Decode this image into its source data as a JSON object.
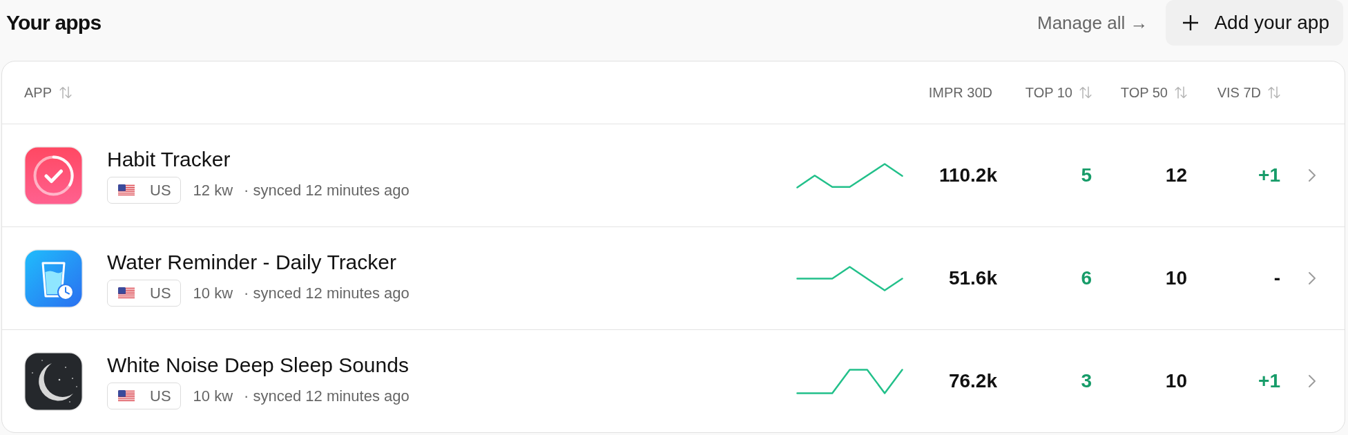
{
  "page": {
    "title": "Your apps"
  },
  "actions": {
    "manage_all": "Manage all →",
    "add_app": "Add your app"
  },
  "table": {
    "columns": [
      {
        "label": "APP",
        "sortable": true
      },
      {
        "label": "IMPR 30D",
        "sortable": false
      },
      {
        "label": "TOP 10",
        "sortable": true
      },
      {
        "label": "TOP 50",
        "sortable": true
      },
      {
        "label": "VIS 7D",
        "sortable": true
      }
    ],
    "rows": [
      {
        "name": "Habit Tracker",
        "country": "US",
        "keywords": "12 kw",
        "synced": "· synced 12 minutes ago",
        "impr_30d": "110.2k",
        "top_10": "5",
        "top_50": "12",
        "vis_7d": "+1",
        "vis_7d_up": true
      },
      {
        "name": "Water Reminder - Daily Tracker",
        "country": "US",
        "keywords": "10 kw",
        "synced": "· synced 12 minutes ago",
        "impr_30d": "51.6k",
        "top_10": "6",
        "top_50": "10",
        "vis_7d": "-",
        "vis_7d_up": false
      },
      {
        "name": "White Noise Deep Sleep Sounds",
        "country": "US",
        "keywords": "10 kw",
        "synced": "· synced 12 minutes ago",
        "impr_30d": "76.2k",
        "top_10": "3",
        "top_50": "10",
        "vis_7d": "+1",
        "vis_7d_up": true
      }
    ]
  }
}
